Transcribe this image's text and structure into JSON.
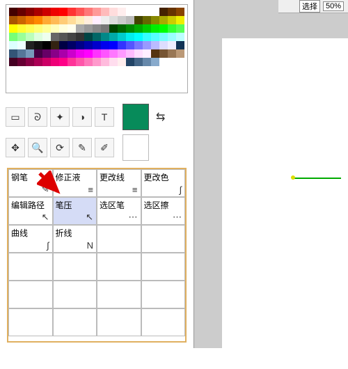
{
  "topbar": {
    "select_label": "选择",
    "zoom": "50%"
  },
  "colors": {
    "accent": "#078b5a"
  },
  "tools": {
    "row1": [
      "rect-select",
      "lasso",
      "wand",
      "shape",
      "text"
    ],
    "row2": [
      "move",
      "zoom",
      "rotate",
      "eyedropper",
      "eyedropper2"
    ]
  },
  "panel": {
    "rows": [
      [
        {
          "label": "钢笔",
          "icon": "✎"
        },
        {
          "label": "修正液",
          "icon": "≡"
        },
        {
          "label": "更改线",
          "icon": "≡"
        },
        {
          "label": "更改色",
          "icon": "∫"
        }
      ],
      [
        {
          "label": "编辑路径",
          "icon": "↖"
        },
        {
          "label": "笔压",
          "icon": "↖",
          "selected": true
        },
        {
          "label": "选区笔",
          "icon": "⋯"
        },
        {
          "label": "选区擦",
          "icon": "⋯"
        }
      ],
      [
        {
          "label": "曲线",
          "icon": "∫"
        },
        {
          "label": "折线",
          "icon": "N"
        },
        {
          "label": "",
          "icon": ""
        },
        {
          "label": "",
          "icon": ""
        }
      ],
      [
        {
          "label": "",
          "icon": ""
        },
        {
          "label": "",
          "icon": ""
        },
        {
          "label": "",
          "icon": ""
        },
        {
          "label": "",
          "icon": ""
        }
      ],
      [
        {
          "label": "",
          "icon": ""
        },
        {
          "label": "",
          "icon": ""
        },
        {
          "label": "",
          "icon": ""
        },
        {
          "label": "",
          "icon": ""
        }
      ],
      [
        {
          "label": "",
          "icon": ""
        },
        {
          "label": "",
          "icon": ""
        },
        {
          "label": "",
          "icon": ""
        },
        {
          "label": "",
          "icon": ""
        }
      ]
    ]
  },
  "palette_colors": [
    "#400",
    "#600",
    "#800",
    "#a00",
    "#c00",
    "#e00",
    "#f00",
    "#f33",
    "#f55",
    "#f77",
    "#f99",
    "#fbb",
    "#fdd",
    "#fee",
    "#fff",
    "#fff",
    "#fff",
    "#fff",
    "#420",
    "#630",
    "#840",
    "#a50",
    "#c60",
    "#e70",
    "#f80",
    "#fa3",
    "#fb5",
    "#fc7",
    "#fd9",
    "#feb",
    "#fed",
    "#fef",
    "#eee",
    "#ddd",
    "#ccc",
    "#bbb",
    "#440",
    "#660",
    "#880",
    "#aa0",
    "#cc0",
    "#ee0",
    "#ff0",
    "#ff3",
    "#ff5",
    "#ff7",
    "#ff9",
    "#ffb",
    "#ffd",
    "#ffe",
    "#aaa",
    "#999",
    "#888",
    "#777",
    "#040",
    "#060",
    "#080",
    "#0a0",
    "#0c0",
    "#0e0",
    "#0f0",
    "#3f3",
    "#5f5",
    "#7f7",
    "#9f9",
    "#bfb",
    "#dfd",
    "#efe",
    "#666",
    "#555",
    "#444",
    "#333",
    "#044",
    "#066",
    "#088",
    "#0aa",
    "#0cc",
    "#0ee",
    "#0ff",
    "#3ff",
    "#5ff",
    "#7ff",
    "#9ff",
    "#bff",
    "#dff",
    "#eff",
    "#222",
    "#111",
    "#000",
    "#321",
    "#004",
    "#006",
    "#008",
    "#00a",
    "#00c",
    "#00e",
    "#00f",
    "#33f",
    "#55f",
    "#77f",
    "#99f",
    "#bbf",
    "#ddf",
    "#eef",
    "#135",
    "#357",
    "#579",
    "#79b",
    "#404",
    "#606",
    "#808",
    "#a0a",
    "#c0c",
    "#e0e",
    "#f0f",
    "#f3f",
    "#f5f",
    "#f7f",
    "#f9f",
    "#fbf",
    "#fdf",
    "#fef",
    "#531",
    "#753",
    "#975",
    "#b97",
    "#402",
    "#603",
    "#804",
    "#a05",
    "#c06",
    "#e07",
    "#f08",
    "#f39",
    "#f5a",
    "#f7b",
    "#f9c",
    "#fbd",
    "#fde",
    "#fee",
    "#246",
    "#468",
    "#68a",
    "#8ac"
  ]
}
